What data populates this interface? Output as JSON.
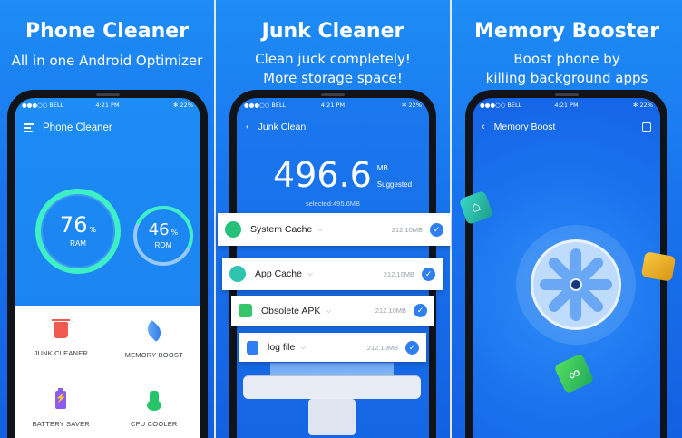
{
  "panels": [
    {
      "headline": "Phone Cleaner",
      "subline": "All in one Android Optimizer",
      "status": {
        "carrier": "●●●○○ BELL",
        "time": "4:21 PM",
        "battery": "✻ 22%"
      },
      "app_title": "Phone Cleaner",
      "ram": {
        "value": "76",
        "unit": "%",
        "label": "RAM",
        "ring_fraction": 0.76
      },
      "rom": {
        "value": "46",
        "unit": "%",
        "label": "ROM",
        "ring_fraction": 0.46
      },
      "tiles": [
        {
          "label": "JUNK CLEANER",
          "icon": "trash-icon"
        },
        {
          "label": "MEMORY BOOST",
          "icon": "rocket-icon"
        },
        {
          "label": "BATTERY SAVER",
          "icon": "battery-icon"
        },
        {
          "label": "CPU COOLER",
          "icon": "thermometer-icon"
        }
      ]
    },
    {
      "headline": "Junk Cleaner",
      "subline_1": "Clean juck completely!",
      "subline_2": "More storage space!",
      "status": {
        "carrier": "●●●○○ BELL",
        "time": "4:21 PM",
        "battery": "✻ 22%"
      },
      "screen_title": "Junk Clean",
      "size_value": "496.6",
      "size_unit": "MB",
      "size_note": "Suggested",
      "selected_text": "selected:495.6MB",
      "items": [
        {
          "name": "System Cache",
          "size": "212.10MB",
          "checked": true
        },
        {
          "name": "App Cache",
          "size": "212.10MB",
          "checked": true
        },
        {
          "name": "Obsolete APK",
          "size": "212.10MB",
          "checked": true
        },
        {
          "name": "log file",
          "size": "212.10MB",
          "checked": true
        }
      ]
    },
    {
      "headline": "Memory Booster",
      "subline_1": "Boost phone by",
      "subline_2": "killing background apps",
      "status": {
        "carrier": "●●●○○ BELL",
        "time": "4:21 PM",
        "battery": "✻ 22%"
      },
      "screen_title": "Memory Boost"
    }
  ],
  "colors": {
    "brand_blue": "#1873ee",
    "ring_accent": "#3df0c5",
    "check_blue": "#2f7ff0"
  }
}
